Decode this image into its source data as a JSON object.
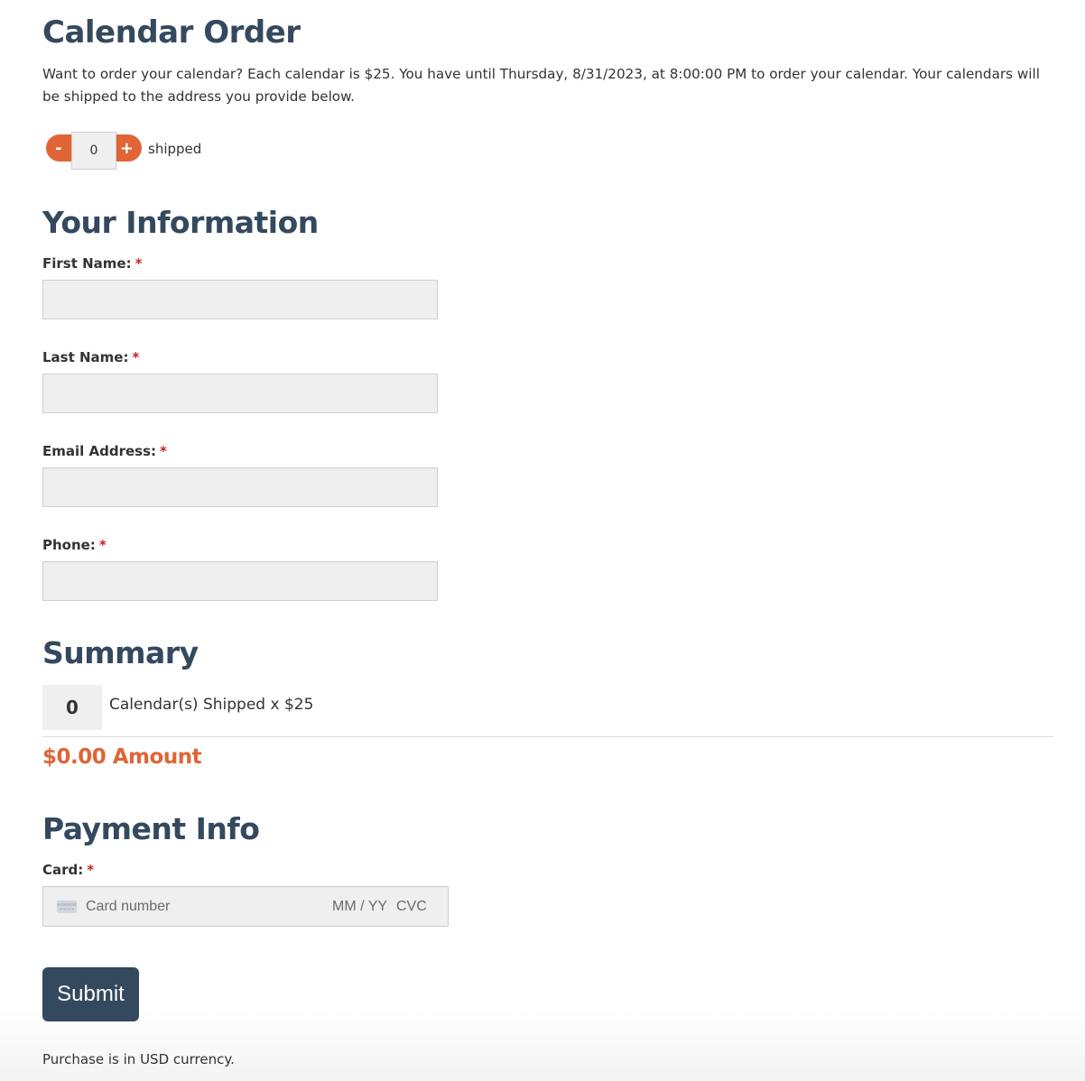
{
  "header": {
    "title": "Calendar Order",
    "intro": "Want to order your calendar? Each calendar is $25. You have until Thursday, 8/31/2023, at 8:00:00 PM to order your calendar. Your calendars will be shipped to the address you provide below."
  },
  "quantity": {
    "minus_label": "-",
    "plus_label": "+",
    "value": "0",
    "label": "shipped"
  },
  "your_info": {
    "heading": "Your Information",
    "required_mark": "*",
    "fields": [
      {
        "label": "First Name:",
        "value": ""
      },
      {
        "label": "Last Name:",
        "value": ""
      },
      {
        "label": "Email Address:",
        "value": ""
      },
      {
        "label": "Phone:",
        "value": ""
      }
    ]
  },
  "summary": {
    "heading": "Summary",
    "count": "0",
    "description": "Calendar(s) Shipped x $25",
    "amount": "$0.00 Amount"
  },
  "payment": {
    "heading": "Payment Info",
    "card_label": "Card:",
    "card_number_placeholder": "Card number",
    "expiry_placeholder": "MM / YY",
    "cvc_placeholder": "CVC",
    "submit_label": "Submit",
    "currency_note": "Purchase is in USD currency."
  },
  "colors": {
    "heading": "#34495e",
    "accent": "#e06436",
    "required": "#cc1f1f",
    "input_bg": "#efefef"
  },
  "icons": {
    "card": "credit-card-icon"
  }
}
